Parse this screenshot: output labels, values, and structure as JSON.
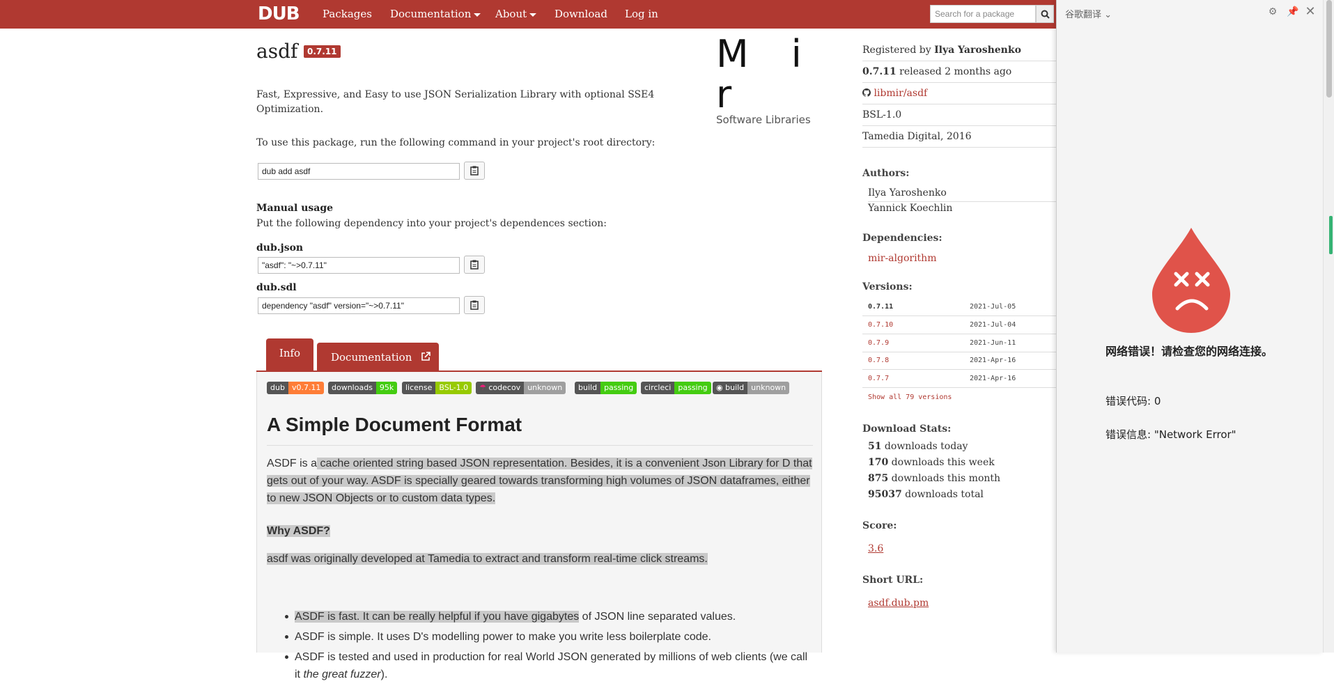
{
  "nav": {
    "logo": "DUB",
    "items": [
      "Packages",
      "Documentation",
      "About",
      "Download",
      "Log in"
    ],
    "search_placeholder": "Search for a package"
  },
  "package": {
    "name": "asdf",
    "version": "0.7.11",
    "description": "Fast, Expressive, and Easy to use JSON Serialization Library with optional SSE4 Optimization.",
    "use_text": "To use this package, run the following command in your project's root directory:",
    "command": "dub add asdf",
    "manual_title": "Manual usage",
    "manual_sub": "Put the following dependency into your project's dependences section:",
    "json_label": "dub.json",
    "json_value": "\"asdf\": \"~>0.7.11\"",
    "sdl_label": "dub.sdl",
    "sdl_value": "dependency \"asdf\" version=\"~>0.7.11\""
  },
  "sponsor": {
    "big": "M i r",
    "small": "Software Libraries"
  },
  "tabs": {
    "info": "Info",
    "documentation": "Documentation"
  },
  "badges": [
    {
      "left": "dub",
      "right": "v0.7.11",
      "color": "#fe7d37"
    },
    {
      "left": "downloads",
      "right": "95k",
      "color": "#4c1"
    },
    {
      "left": "license",
      "right": "BSL-1.0",
      "color": "#97ca00"
    },
    {
      "left": "codecov",
      "right": "unknown",
      "color": "#9f9f9f"
    },
    {
      "left": "build",
      "right": "passing",
      "color": "#4c1"
    },
    {
      "left": "circleci",
      "right": "passing",
      "color": "#4c1"
    },
    {
      "left": "build",
      "right": "unknown",
      "color": "#9f9f9f"
    }
  ],
  "readme": {
    "heading": "A Simple Document Format",
    "p1_a": "ASDF is a",
    "p1_b": " cache oriented string based JSON representation. Besides, it is a convenient Json Library for D that gets out of your way. ASDF is specially geared towards transforming high volumes of JSON dataframes, either to new JSON Objects or to custom data types. ",
    "why": "Why ASDF?",
    "p2": "asdf was originally developed at Tamedia to extract and transform real-time click streams. ",
    "bullets": [
      {
        "hl": "ASDF is fast. It can be really helpful if you have gigabytes",
        "rest": " of JSON line separated values."
      },
      {
        "hl": "",
        "rest": "ASDF is simple. It uses D's modelling power to make you write less boilerplate code."
      },
      {
        "hl": "",
        "rest": "ASDF is tested and used in production for real World JSON generated by millions of web clients (we call it ",
        "em": "the great fuzzer",
        "tail": ")."
      }
    ]
  },
  "sidebar": {
    "registered_prefix": "Registered by ",
    "registered_by": "Ilya Yaroshenko",
    "released_version": "0.7.11",
    "released_text": " released 2 months ago",
    "repo": "libmir/asdf",
    "license": "BSL-1.0",
    "copyright": "Tamedia Digital, 2016",
    "authors_label": "Authors:",
    "authors": [
      "Ilya Yaroshenko",
      "Yannick Koechlin"
    ],
    "deps_label": "Dependencies:",
    "deps": [
      "mir-algorithm"
    ],
    "versions_label": "Versions:",
    "versions": [
      {
        "v": "0.7.11",
        "d": "2021-Jul-05"
      },
      {
        "v": "0.7.10",
        "d": "2021-Jul-04"
      },
      {
        "v": "0.7.9",
        "d": "2021-Jun-11"
      },
      {
        "v": "0.7.8",
        "d": "2021-Apr-16"
      },
      {
        "v": "0.7.7",
        "d": "2021-Apr-16"
      }
    ],
    "show_all": "Show all 79 versions",
    "stats_label": "Download Stats:",
    "stats": [
      {
        "n": "51",
        "t": " downloads today"
      },
      {
        "n": "170",
        "t": " downloads this week"
      },
      {
        "n": "875",
        "t": " downloads this month"
      },
      {
        "n": "95037",
        "t": " downloads total"
      }
    ],
    "score_label": "Score:",
    "score": "3.6",
    "short_label": "Short URL:",
    "short_url": "asdf.dub.pm"
  },
  "translate": {
    "title": "谷歌翻译",
    "error_title": "网络错误！请检查您的网络连接。",
    "error_code": "错误代码: 0",
    "error_msg": "错误信息: \"Network Error\""
  }
}
